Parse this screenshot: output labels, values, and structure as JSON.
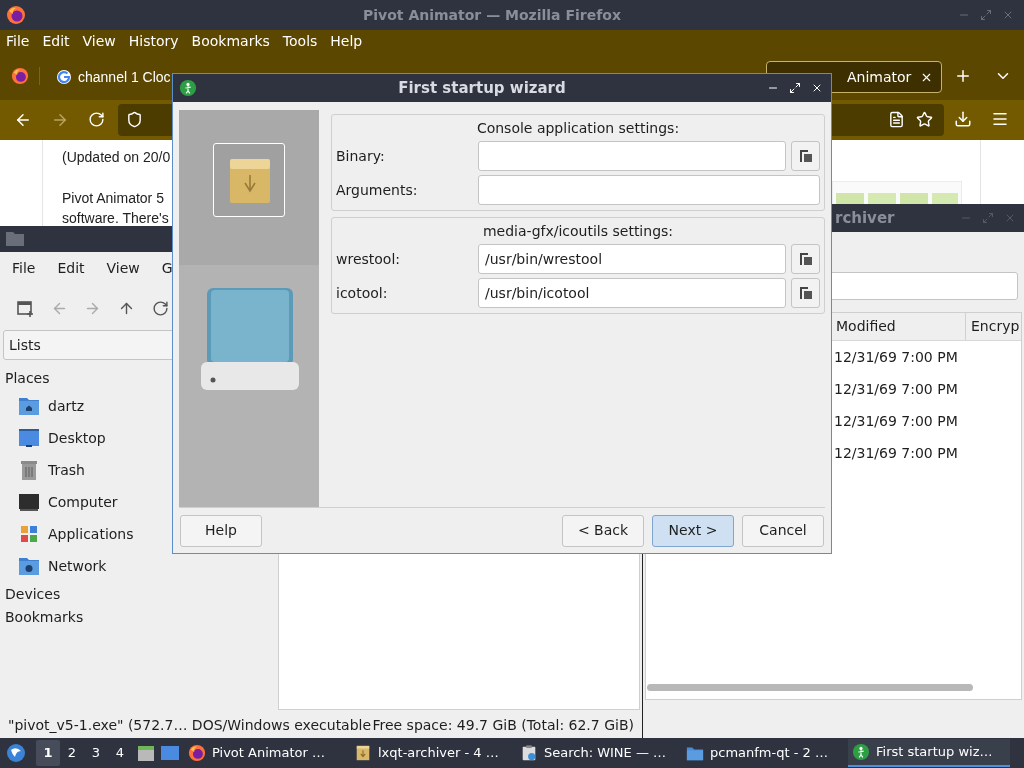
{
  "firefox": {
    "title": "Pivot Animator — Mozilla Firefox",
    "menu": [
      "File",
      "Edit",
      "View",
      "History",
      "Bookmarks",
      "Tools",
      "Help"
    ],
    "tabs": [
      {
        "label": "channel 1 Cloc",
        "selected": false
      },
      {
        "label": "Animator",
        "selected": true
      }
    ],
    "content": {
      "updated": "(Updated on 20/0",
      "lines": [
        "Pivot Animator 5",
        "software. There's"
      ]
    }
  },
  "file_manager": {
    "menu": [
      "File",
      "Edit",
      "View",
      "G"
    ],
    "view_mode": "Lists",
    "places_heading": "Places",
    "places": [
      {
        "label": "dartz",
        "kind": "home"
      },
      {
        "label": "Desktop",
        "kind": "desktop"
      },
      {
        "label": "Trash",
        "kind": "trash"
      },
      {
        "label": "Computer",
        "kind": "computer"
      },
      {
        "label": "Applications",
        "kind": "apps"
      },
      {
        "label": "Network",
        "kind": "network"
      }
    ],
    "sections": [
      "Devices",
      "Bookmarks"
    ],
    "status": [
      "\"pivot_v5-1.exe\" (572.7… DOS/Windows executable",
      "Free space: 49.7 GiB (Total: 62.7 GiB)"
    ]
  },
  "archiver": {
    "title": "rchiver",
    "columns": [
      "Modified",
      "Encryp"
    ],
    "rows": [
      {
        "modified": "12/31/69 7:00 PM"
      },
      {
        "modified": "12/31/69 7:00 PM"
      },
      {
        "modified": "12/31/69 7:00 PM"
      },
      {
        "modified": "12/31/69 7:00 PM"
      }
    ]
  },
  "dialog": {
    "title": "First startup wizard",
    "sections": [
      {
        "heading": "Console application settings:",
        "fields": [
          {
            "label": "Binary:",
            "browse": true
          },
          {
            "label": "Arguments:",
            "browse": false
          }
        ]
      },
      {
        "heading": "media-gfx/icoutils settings:",
        "fields": [
          {
            "label": "wrestool:",
            "value": "/usr/bin/wrestool",
            "browse": true
          },
          {
            "label": "icotool:",
            "value": "/usr/bin/icotool",
            "browse": true
          }
        ]
      }
    ],
    "buttons": [
      {
        "label": "Help",
        "default": false
      },
      {
        "label": "< Back",
        "default": false
      },
      {
        "label": "Next >",
        "default": true
      },
      {
        "label": "Cancel",
        "default": false
      }
    ]
  },
  "taskbar": {
    "desktops": [
      {
        "label": "1",
        "selected": true
      },
      {
        "label": "2",
        "selected": false
      },
      {
        "label": "3",
        "selected": false
      },
      {
        "label": "4",
        "selected": false
      }
    ],
    "tasks": [
      {
        "label": "Pivot Animator …",
        "kind": "firefox",
        "selected": false
      },
      {
        "label": "lxqt-archiver - 4 …",
        "kind": "package",
        "selected": false
      },
      {
        "label": "Search: WINE — …",
        "kind": "search",
        "selected": false
      },
      {
        "label": "pcmanfm-qt - 2 …",
        "kind": "folder",
        "selected": false
      },
      {
        "label": "First startup wiz…",
        "kind": "pivot",
        "selected": true
      }
    ]
  }
}
